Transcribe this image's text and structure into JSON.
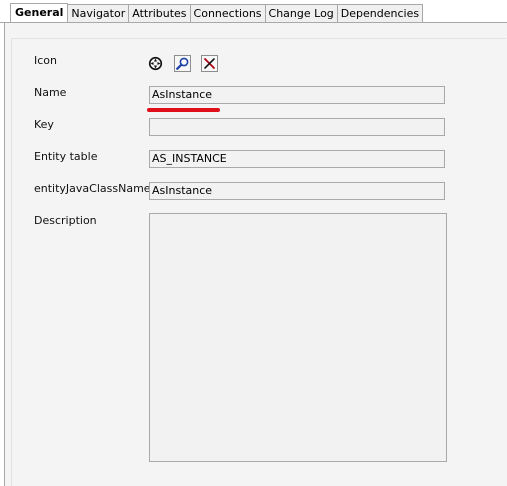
{
  "tabs": [
    {
      "label": "General",
      "active": true
    },
    {
      "label": "Navigator",
      "active": false
    },
    {
      "label": "Attributes",
      "active": false
    },
    {
      "label": "Connections",
      "active": false
    },
    {
      "label": "Change Log",
      "active": false
    },
    {
      "label": "Dependencies",
      "active": false
    }
  ],
  "form": {
    "icon_label": "Icon",
    "name_label": "Name",
    "name_value": "AsInstance",
    "key_label": "Key",
    "key_value": "",
    "entity_table_label": "Entity table",
    "entity_table_value": "AS_INSTANCE",
    "entity_java_class_label": "entityJavaClassName",
    "entity_java_class_value": "AsInstance",
    "description_label": "Description",
    "description_value": ""
  },
  "icons": {
    "default_icon": "crosshair-icon",
    "search_icon": "magnifier-icon",
    "clear_icon": "clear-x-icon"
  },
  "colors": {
    "highlight_underline": "#e0101a",
    "tab_border": "#a8a8a8",
    "panel_bg": "#f4f4f4"
  }
}
